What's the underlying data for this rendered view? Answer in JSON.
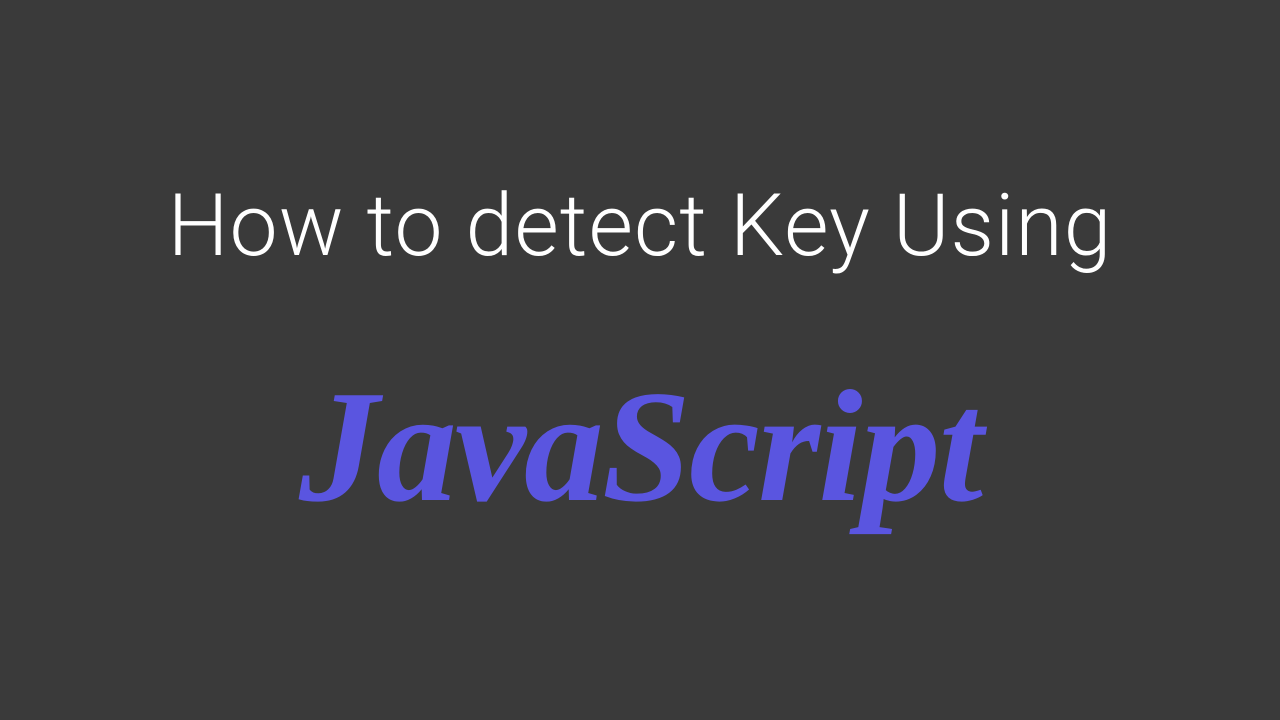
{
  "title": {
    "line1": "How to detect Key Using",
    "accent": "JavaScript"
  },
  "colors": {
    "background": "#3a3a3a",
    "text": "#ffffff",
    "accent": "#5a55e0"
  }
}
